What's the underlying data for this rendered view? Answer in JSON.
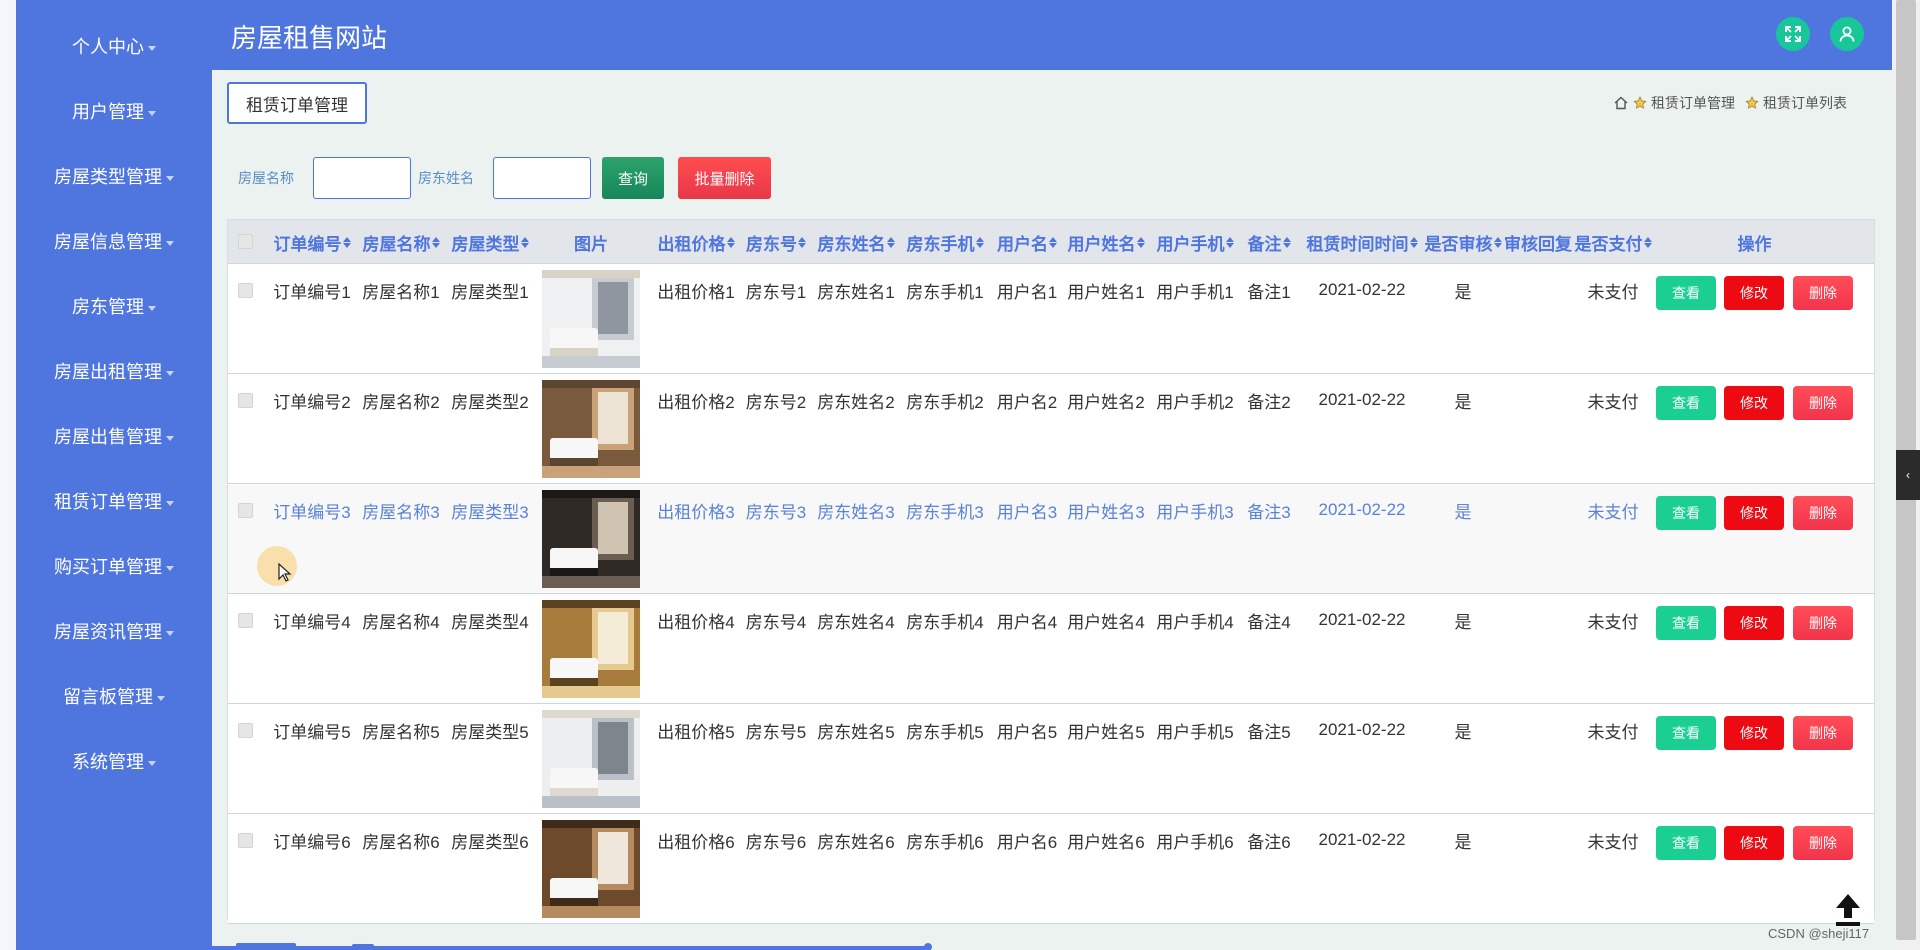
{
  "app": {
    "title": "房屋租售网站"
  },
  "sidebar": {
    "items": [
      {
        "label": "个人中心"
      },
      {
        "label": "用户管理"
      },
      {
        "label": "房屋类型管理"
      },
      {
        "label": "房屋信息管理"
      },
      {
        "label": "房东管理"
      },
      {
        "label": "房屋出租管理"
      },
      {
        "label": "房屋出售管理"
      },
      {
        "label": "租赁订单管理"
      },
      {
        "label": "购买订单管理"
      },
      {
        "label": "房屋资讯管理"
      },
      {
        "label": "留言板管理"
      },
      {
        "label": "系统管理"
      }
    ]
  },
  "page": {
    "tab_label": "租赁订单管理"
  },
  "breadcrumb": {
    "items": [
      "租赁订单管理",
      "租赁订单列表"
    ]
  },
  "search": {
    "fields": [
      {
        "label": "房屋名称",
        "value": ""
      },
      {
        "label": "房东姓名",
        "value": ""
      }
    ],
    "query_label": "查询",
    "batch_delete_label": "批量删除"
  },
  "table": {
    "headers": [
      "订单编号",
      "房屋名称",
      "房屋类型",
      "图片",
      "出租价格",
      "房东号",
      "房东姓名",
      "房东手机",
      "用户名",
      "用户姓名",
      "用户手机",
      "备注",
      "租赁时间时间",
      "是否审核",
      "审核回复",
      "是否支付",
      "操作"
    ],
    "rows": [
      [
        "订单编号1",
        "房屋名称1",
        "房屋类型1",
        "出租价格1",
        "房东号1",
        "房东姓名1",
        "房东手机1",
        "用户名1",
        "用户姓名1",
        "用户手机1",
        "备注1",
        "2021-02-22",
        "是",
        "",
        "未支付"
      ],
      [
        "订单编号2",
        "房屋名称2",
        "房屋类型2",
        "出租价格2",
        "房东号2",
        "房东姓名2",
        "房东手机2",
        "用户名2",
        "用户姓名2",
        "用户手机2",
        "备注2",
        "2021-02-22",
        "是",
        "",
        "未支付"
      ],
      [
        "订单编号3",
        "房屋名称3",
        "房屋类型3",
        "出租价格3",
        "房东号3",
        "房东姓名3",
        "房东手机3",
        "用户名3",
        "用户姓名3",
        "用户手机3",
        "备注3",
        "2021-02-22",
        "是",
        "",
        "未支付"
      ],
      [
        "订单编号4",
        "房屋名称4",
        "房屋类型4",
        "出租价格4",
        "房东号4",
        "房东姓名4",
        "房东手机4",
        "用户名4",
        "用户姓名4",
        "用户手机4",
        "备注4",
        "2021-02-22",
        "是",
        "",
        "未支付"
      ],
      [
        "订单编号5",
        "房屋名称5",
        "房屋类型5",
        "出租价格5",
        "房东号5",
        "房东姓名5",
        "房东手机5",
        "用户名5",
        "用户姓名5",
        "用户手机5",
        "备注5",
        "2021-02-22",
        "是",
        "",
        "未支付"
      ],
      [
        "订单编号6",
        "房屋名称6",
        "房屋类型6",
        "出租价格6",
        "房东号6",
        "房东姓名6",
        "房东手机6",
        "用户名6",
        "用户姓名6",
        "用户手机6",
        "备注6",
        "2021-02-22",
        "是",
        "",
        "未支付"
      ]
    ],
    "actions": {
      "view": "查看",
      "edit": "修改",
      "delete": "删除"
    }
  },
  "watermark": "CSDN @sheji117",
  "colors": {
    "primary": "#4f75df",
    "teal": "#17c79a",
    "red": "#ee0a12",
    "green": "#1bcf92"
  },
  "icons": {
    "fullscreen": "expand-icon",
    "user": "user-icon",
    "home": "home-icon",
    "star": "star-icon",
    "back_to_top": "arrow-up-icon"
  }
}
